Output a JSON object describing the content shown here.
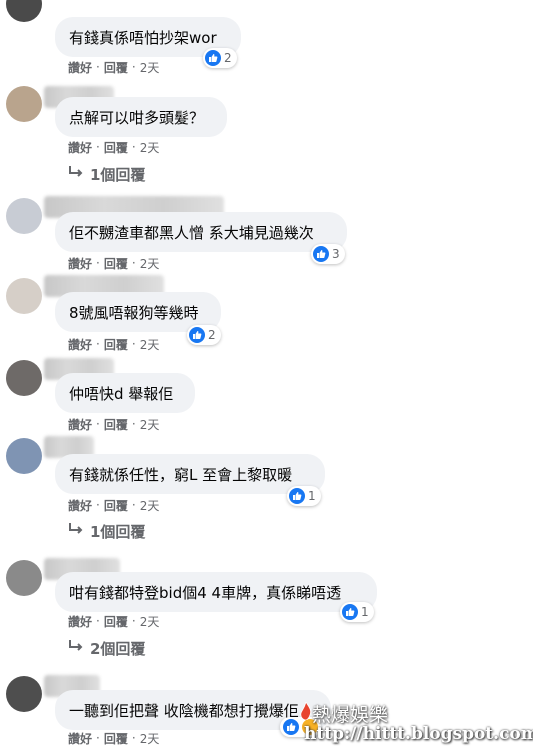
{
  "comments": [
    {
      "text": "有錢真係唔怕抄架wor",
      "likes": "2",
      "actions": {
        "like": "讚好",
        "reply": "回覆",
        "time": "2天"
      },
      "replies": ""
    },
    {
      "text": "点解可以咁多頭髮？",
      "likes": "",
      "actions": {
        "like": "讚好",
        "reply": "回覆",
        "time": "2天"
      },
      "replies": "1個回覆"
    },
    {
      "text": "佢不嬲渣車都黑人憎 系大埔見過幾次",
      "likes": "3",
      "actions": {
        "like": "讚好",
        "reply": "回覆",
        "time": "2天"
      },
      "replies": ""
    },
    {
      "text": "8號風唔報狗等幾時",
      "likes": "2",
      "actions": {
        "like": "讚好",
        "reply": "回覆",
        "time": "2天"
      },
      "replies": ""
    },
    {
      "text": "仲唔快d 舉報佢",
      "likes": "",
      "actions": {
        "like": "讚好",
        "reply": "回覆",
        "time": "2天"
      },
      "replies": ""
    },
    {
      "text": "有錢就係任性，窮L 至會上黎取暖",
      "likes": "1",
      "actions": {
        "like": "讚好",
        "reply": "回覆",
        "time": "2天"
      },
      "replies": "1個回覆"
    },
    {
      "text": "咁有錢都特登bid個4 4車牌，真係睇唔透",
      "likes": "1",
      "actions": {
        "like": "讚好",
        "reply": "回覆",
        "time": "2天"
      },
      "replies": "2個回覆"
    },
    {
      "text": "一聽到佢把聲 收陰機都想打攪爆佢",
      "likes": "",
      "actions": {
        "like": "讚好",
        "reply": "回覆",
        "time": "2天"
      },
      "replies": ""
    }
  ],
  "watermark": {
    "title": "熱爆娛樂",
    "url": "http://hittt.blogspot.com"
  },
  "colors": {
    "bubble": "#f0f2f5",
    "like_blue": "#1877f2",
    "meta_gray": "#65676b"
  }
}
